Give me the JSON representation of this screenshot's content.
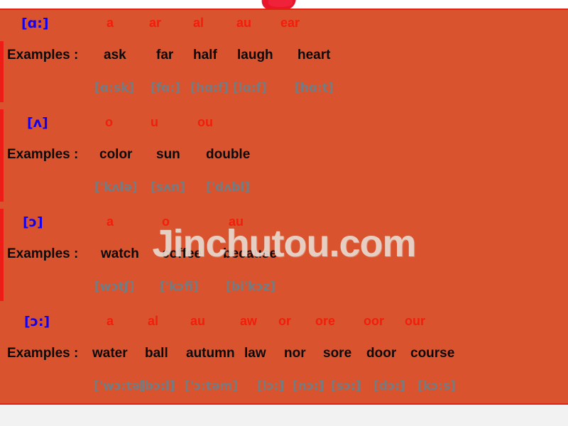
{
  "slide": {
    "watermark": "Jinchutou.com",
    "background_color": "#d9542e",
    "symbol_color": "#1200ee",
    "spelling_color": "#f01e0a",
    "word_color": "#0a0a0a",
    "ipa_color": "#717d83",
    "border_color": "#e32213"
  },
  "groups": [
    {
      "symbol": "[ɑ:]",
      "examples_label": "Examples :",
      "spellings": [
        "a",
        "ar",
        "al",
        "au",
        "ear"
      ],
      "words": [
        "ask",
        "far",
        "half",
        "laugh",
        "heart"
      ],
      "ipa": [
        "[ɑ:sk]",
        "[fɑ:]",
        "[hɑ:f]",
        "[lɑ:f]",
        "[hɑ:t]"
      ]
    },
    {
      "symbol": "[ʌ]",
      "examples_label": "Examples :",
      "spellings": [
        "o",
        "u",
        "ou"
      ],
      "words": [
        "color",
        "sun",
        "double"
      ],
      "ipa": [
        "['kʌlə]",
        "[sʌn]",
        "['dʌbl]"
      ]
    },
    {
      "symbol": "[ɔ]",
      "examples_label": "Examples :",
      "spellings": [
        "a",
        "o",
        "au"
      ],
      "words": [
        "watch",
        "coffee",
        "because"
      ],
      "ipa": [
        "[wɔtʃ]",
        "['kɔfi]",
        "[bi'kɔz]"
      ]
    },
    {
      "symbol": "[ɔ:]",
      "examples_label": "Examples :",
      "spellings": [
        "a",
        "al",
        "au",
        "aw",
        "or",
        "ore",
        "oor",
        "our"
      ],
      "words": [
        "water",
        "ball",
        "autumn",
        "law",
        "nor",
        "sore",
        "door",
        "course"
      ],
      "ipa": [
        "['wɔ:tə]",
        "[bɔ:l]",
        "['ɔ:təm]",
        "[lɔ:]",
        "[nɔ:]",
        "[sɔ:]",
        "[dɔ:]",
        "[kɔ:s]"
      ]
    }
  ],
  "layout": {
    "group_tops": [
      8,
      148,
      288,
      428
    ],
    "symbol_lefts": [
      30,
      38,
      32,
      34
    ],
    "spelling_lefts": [
      [
        150,
        210,
        272,
        333,
        395
      ],
      [
        148,
        212,
        278
      ],
      [
        150,
        228,
        322
      ],
      [
        150,
        208,
        268,
        338,
        392,
        444,
        512,
        570
      ]
    ],
    "word_lefts": [
      [
        146,
        220,
        272,
        334,
        419
      ],
      [
        140,
        220,
        290
      ],
      [
        142,
        228,
        314
      ],
      [
        130,
        204,
        262,
        344,
        400,
        455,
        516,
        578
      ]
    ],
    "ipa_lefts": [
      [
        133,
        212,
        268,
        328,
        415
      ],
      [
        133,
        212,
        290
      ],
      [
        133,
        225,
        318
      ],
      [
        132,
        196,
        260,
        362,
        412,
        466,
        526,
        588
      ]
    ]
  }
}
